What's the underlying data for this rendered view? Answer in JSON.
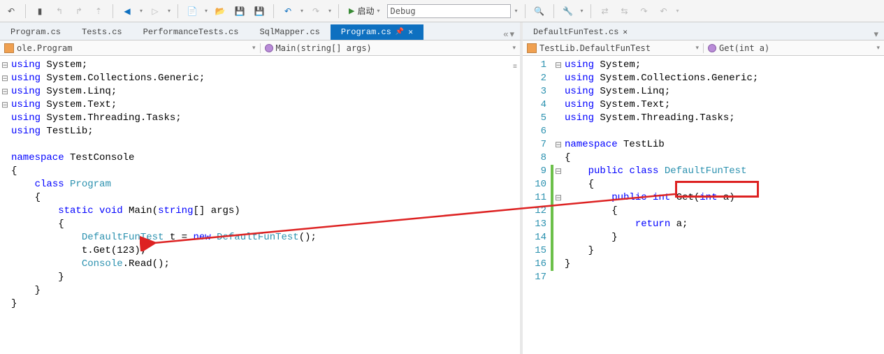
{
  "toolbar": {
    "start_label": "启动",
    "config": "Debug"
  },
  "tabs_left": [
    {
      "label": "Program.cs",
      "active": false
    },
    {
      "label": "Tests.cs",
      "active": false
    },
    {
      "label": "PerformanceTests.cs",
      "active": false
    },
    {
      "label": "SqlMapper.cs",
      "active": false
    },
    {
      "label": "Program.cs",
      "active": true,
      "pinned": true
    }
  ],
  "tabs_right": [
    {
      "label": "DefaultFunTest.cs",
      "active": false
    }
  ],
  "nav": {
    "left_class": "ole.Program",
    "left_member": "Main(string[] args)",
    "right_class": "TestLib.DefaultFunTest",
    "right_member": "Get(int a)"
  },
  "left_code": [
    [
      {
        "t": "kw",
        "v": "using"
      },
      {
        "t": "pln",
        "v": " System;"
      }
    ],
    [
      {
        "t": "kw",
        "v": "using"
      },
      {
        "t": "pln",
        "v": " System.Collections.Generic;"
      }
    ],
    [
      {
        "t": "kw",
        "v": "using"
      },
      {
        "t": "pln",
        "v": " System.Linq;"
      }
    ],
    [
      {
        "t": "kw",
        "v": "using"
      },
      {
        "t": "pln",
        "v": " System.Text;"
      }
    ],
    [
      {
        "t": "kw",
        "v": "using"
      },
      {
        "t": "pln",
        "v": " System.Threading.Tasks;"
      }
    ],
    [
      {
        "t": "kw",
        "v": "using"
      },
      {
        "t": "pln",
        "v": " TestLib;"
      }
    ],
    [
      {
        "t": "pln",
        "v": ""
      }
    ],
    [
      {
        "t": "kw",
        "v": "namespace"
      },
      {
        "t": "pln",
        "v": " TestConsole"
      }
    ],
    [
      {
        "t": "pln",
        "v": "{"
      }
    ],
    [
      {
        "t": "pln",
        "v": "    "
      },
      {
        "t": "kw",
        "v": "class"
      },
      {
        "t": "pln",
        "v": " "
      },
      {
        "t": "typ",
        "v": "Program"
      }
    ],
    [
      {
        "t": "pln",
        "v": "    {"
      }
    ],
    [
      {
        "t": "pln",
        "v": "        "
      },
      {
        "t": "kw",
        "v": "static"
      },
      {
        "t": "pln",
        "v": " "
      },
      {
        "t": "kw",
        "v": "void"
      },
      {
        "t": "pln",
        "v": " Main("
      },
      {
        "t": "kw",
        "v": "string"
      },
      {
        "t": "pln",
        "v": "[] args)"
      }
    ],
    [
      {
        "t": "pln",
        "v": "        {"
      }
    ],
    [
      {
        "t": "pln",
        "v": "            "
      },
      {
        "t": "typ",
        "v": "DefaultFunTest"
      },
      {
        "t": "pln",
        "v": " t = "
      },
      {
        "t": "kw",
        "v": "new"
      },
      {
        "t": "pln",
        "v": " "
      },
      {
        "t": "typ",
        "v": "DefaultFunTest"
      },
      {
        "t": "pln",
        "v": "();"
      }
    ],
    [
      {
        "t": "pln",
        "v": "            t.Get(123);"
      }
    ],
    [
      {
        "t": "pln",
        "v": "            "
      },
      {
        "t": "typ",
        "v": "Console"
      },
      {
        "t": "pln",
        "v": ".Read();"
      }
    ],
    [
      {
        "t": "pln",
        "v": "        }"
      }
    ],
    [
      {
        "t": "pln",
        "v": "    }"
      }
    ],
    [
      {
        "t": "pln",
        "v": "}"
      }
    ]
  ],
  "right_lines": [
    1,
    2,
    3,
    4,
    5,
    6,
    7,
    8,
    9,
    10,
    11,
    12,
    13,
    14,
    15,
    16,
    17
  ],
  "right_code": [
    [
      {
        "t": "kw",
        "v": "using"
      },
      {
        "t": "pln",
        "v": " System;"
      }
    ],
    [
      {
        "t": "kw",
        "v": "using"
      },
      {
        "t": "pln",
        "v": " System.Collections.Generic;"
      }
    ],
    [
      {
        "t": "kw",
        "v": "using"
      },
      {
        "t": "pln",
        "v": " System.Linq;"
      }
    ],
    [
      {
        "t": "kw",
        "v": "using"
      },
      {
        "t": "pln",
        "v": " System.Text;"
      }
    ],
    [
      {
        "t": "kw",
        "v": "using"
      },
      {
        "t": "pln",
        "v": " System.Threading.Tasks;"
      }
    ],
    [
      {
        "t": "pln",
        "v": ""
      }
    ],
    [
      {
        "t": "kw",
        "v": "namespace"
      },
      {
        "t": "pln",
        "v": " TestLib"
      }
    ],
    [
      {
        "t": "pln",
        "v": "{"
      }
    ],
    [
      {
        "t": "pln",
        "v": "    "
      },
      {
        "t": "kw",
        "v": "public"
      },
      {
        "t": "pln",
        "v": " "
      },
      {
        "t": "kw",
        "v": "class"
      },
      {
        "t": "pln",
        "v": " "
      },
      {
        "t": "typ",
        "v": "DefaultFunTest"
      }
    ],
    [
      {
        "t": "pln",
        "v": "    {"
      }
    ],
    [
      {
        "t": "pln",
        "v": "        "
      },
      {
        "t": "kw",
        "v": "public"
      },
      {
        "t": "pln",
        "v": " "
      },
      {
        "t": "kw",
        "v": "int"
      },
      {
        "t": "pln",
        "v": " Get("
      },
      {
        "t": "kw",
        "v": "int"
      },
      {
        "t": "pln",
        "v": " a)"
      }
    ],
    [
      {
        "t": "pln",
        "v": "        {"
      }
    ],
    [
      {
        "t": "pln",
        "v": "            "
      },
      {
        "t": "kw",
        "v": "return"
      },
      {
        "t": "pln",
        "v": " a;"
      }
    ],
    [
      {
        "t": "pln",
        "v": "        }"
      }
    ],
    [
      {
        "t": "pln",
        "v": "    }"
      }
    ],
    [
      {
        "t": "pln",
        "v": "}"
      }
    ],
    [
      {
        "t": "pln",
        "v": ""
      }
    ]
  ],
  "right_changed": [
    9,
    10,
    11,
    12,
    13,
    14,
    15,
    16
  ]
}
